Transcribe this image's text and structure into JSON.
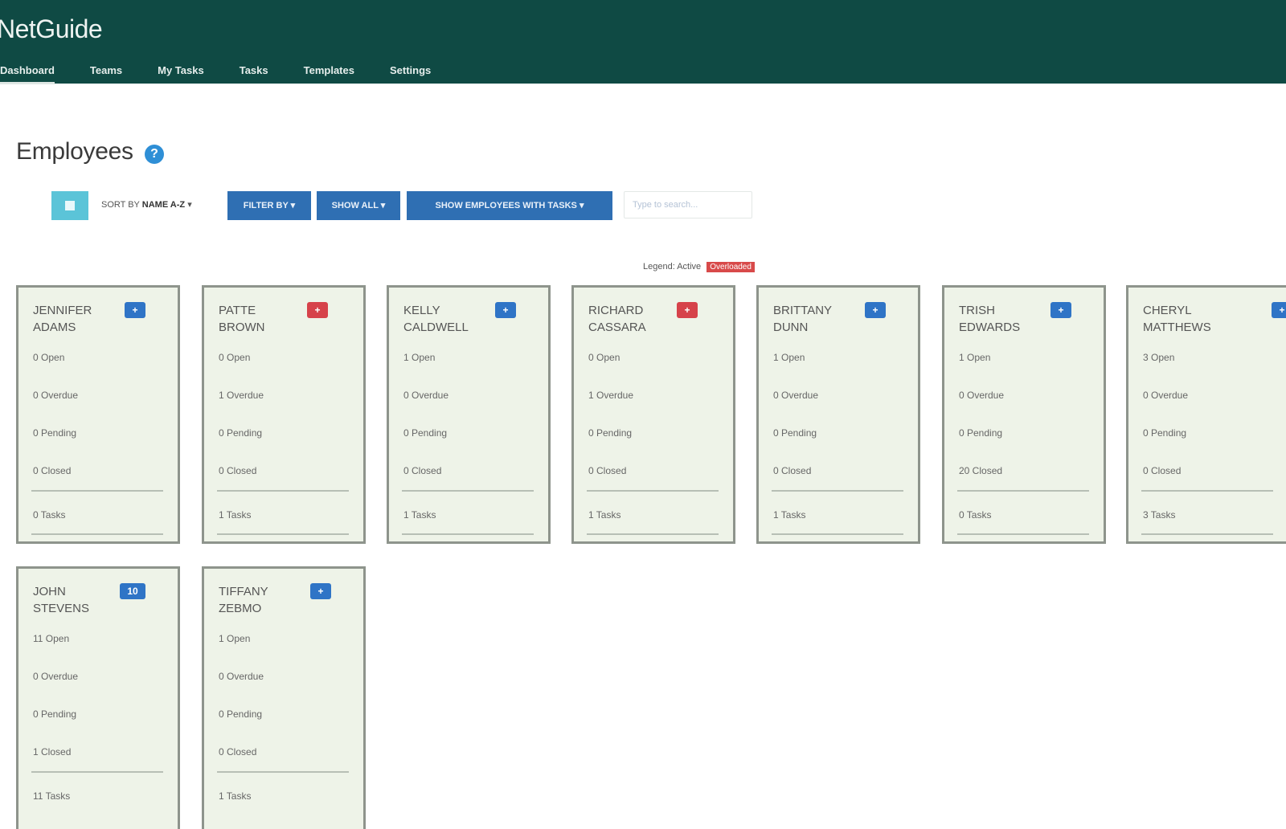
{
  "app": {
    "brand": "NetGuide"
  },
  "nav": [
    {
      "label": "Dashboard",
      "active": true
    },
    {
      "label": "Teams",
      "active": false
    },
    {
      "label": "My Tasks",
      "active": false
    },
    {
      "label": "Tasks",
      "active": false
    },
    {
      "label": "Templates",
      "active": false
    },
    {
      "label": "Settings",
      "active": false
    }
  ],
  "page": {
    "title": "Employees",
    "help_icon": "?"
  },
  "toolbar": {
    "view_icon": "grid-view-icon",
    "sort_prefix": "SORT BY",
    "sort_value": "NAME A-Z",
    "filter_label": "FILTER BY",
    "show_all_label": "SHOW ALL",
    "employee_label": "SHOW EMPLOYEES WITH TASKS",
    "search_placeholder": "Type to search..."
  },
  "legend": {
    "text": "Legend: Active",
    "tag": "Overloaded"
  },
  "employees": [
    {
      "first": "JENNIFER",
      "last": "ADAMS",
      "badge": "+",
      "badge_color": "blue",
      "open": "0 Open",
      "overdue": "0 Overdue",
      "pending": "0 Pending",
      "closed": "0 Closed",
      "tasks": "0 Tasks"
    },
    {
      "first": "PATTE",
      "last": "BROWN",
      "badge": "+",
      "badge_color": "red",
      "open": "0 Open",
      "overdue": "1 Overdue",
      "pending": "0 Pending",
      "closed": "0 Closed",
      "tasks": "1 Tasks"
    },
    {
      "first": "KELLY",
      "last": "CALDWELL",
      "badge": "+",
      "badge_color": "blue",
      "open": "1 Open",
      "overdue": "0 Overdue",
      "pending": "0 Pending",
      "closed": "0 Closed",
      "tasks": "1 Tasks"
    },
    {
      "first": "RICHARD",
      "last": "CASSARA",
      "badge": "+",
      "badge_color": "red",
      "open": "0 Open",
      "overdue": "1 Overdue",
      "pending": "0 Pending",
      "closed": "0 Closed",
      "tasks": "1 Tasks"
    },
    {
      "first": "BRITTANY",
      "last": "DUNN",
      "badge": "+",
      "badge_color": "blue",
      "open": "1 Open",
      "overdue": "0 Overdue",
      "pending": "0 Pending",
      "closed": "0 Closed",
      "tasks": "1 Tasks"
    },
    {
      "first": "TRISH",
      "last": "EDWARDS",
      "badge": "+",
      "badge_color": "blue",
      "open": "1 Open",
      "overdue": "0 Overdue",
      "pending": "0 Pending",
      "closed": "20 Closed",
      "tasks": "0 Tasks"
    },
    {
      "first": "CHERYL",
      "last": "MATTHEWS",
      "badge": "+",
      "badge_color": "blue",
      "open": "3 Open",
      "overdue": "0 Overdue",
      "pending": "0 Pending",
      "closed": "0 Closed",
      "tasks": "3 Tasks"
    },
    {
      "first": "JOHN",
      "last": "STEVENS",
      "badge": "10",
      "badge_color": "blue",
      "open": "11 Open",
      "overdue": "0 Overdue",
      "pending": "0 Pending",
      "closed": "1 Closed",
      "tasks": "11 Tasks"
    },
    {
      "first": "TIFFANY",
      "last": "ZEBMO",
      "badge": "+",
      "badge_color": "blue",
      "open": "1 Open",
      "overdue": "0 Overdue",
      "pending": "0 Pending",
      "closed": "0 Closed",
      "tasks": "1 Tasks"
    }
  ]
}
